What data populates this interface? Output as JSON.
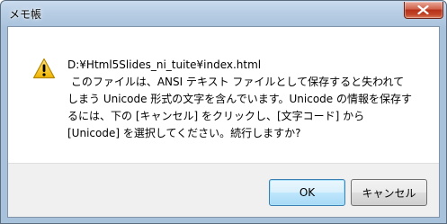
{
  "window": {
    "title": "メモ帳"
  },
  "message": {
    "lines": [
      "D:¥Html5Slides_ni_tuite¥index.html",
      " このファイルは、ANSI テキスト ファイルとして保存すると失われて",
      "しまう Unicode 形式の文字を含んでいます。Unicode の情報を保存す",
      "るには、下の [キャンセル] をクリックし、[文字コード] から",
      "[Unicode] を選択してください。続行しますか?"
    ]
  },
  "icons": {
    "warning": "warning-icon",
    "close": "close-icon"
  },
  "buttons": {
    "ok_label": "OK",
    "cancel_label": "キャンセル"
  },
  "colors": {
    "warning_fill": "#f5c211",
    "close_button": "#c2452a",
    "default_button_border": "#3c7fb1"
  }
}
